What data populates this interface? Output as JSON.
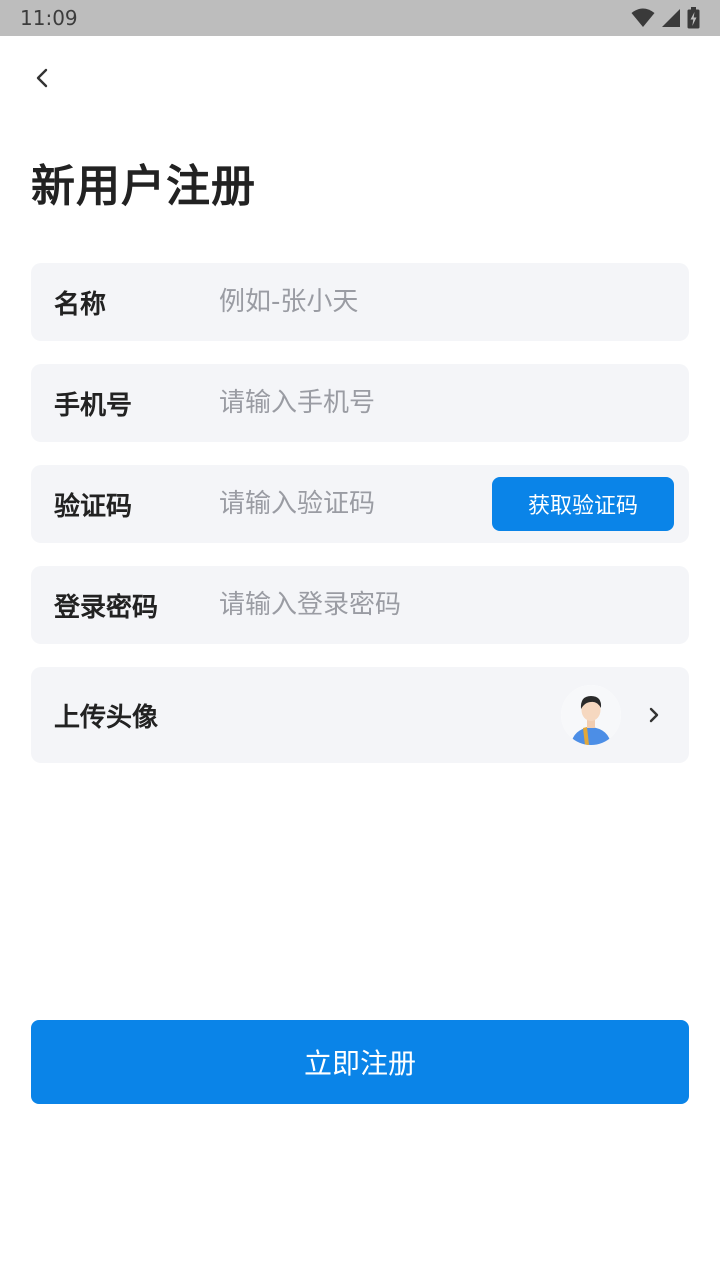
{
  "status_bar": {
    "time": "11:09",
    "icons": [
      "wifi-icon",
      "signal-icon",
      "battery-charging-icon"
    ]
  },
  "header": {
    "back_icon": "chevron-left-icon",
    "title": "新用户注册"
  },
  "form": {
    "name": {
      "label": "名称",
      "placeholder": "例如-张小天",
      "value": ""
    },
    "phone": {
      "label": "手机号",
      "placeholder": "请输入手机号",
      "value": ""
    },
    "code": {
      "label": "验证码",
      "placeholder": "请输入验证码",
      "value": "",
      "button_label": "获取验证码"
    },
    "password": {
      "label": "登录密码",
      "placeholder": "请输入登录密码",
      "value": ""
    },
    "avatar": {
      "label": "上传头像",
      "icon": "chevron-right-icon"
    }
  },
  "submit": {
    "label": "立即注册"
  },
  "colors": {
    "accent": "#0a84e8",
    "field_bg": "#f4f5f8",
    "title_text": "#222222",
    "placeholder": "#9a9ca3",
    "status_bar_bg": "#bdbdbd"
  }
}
